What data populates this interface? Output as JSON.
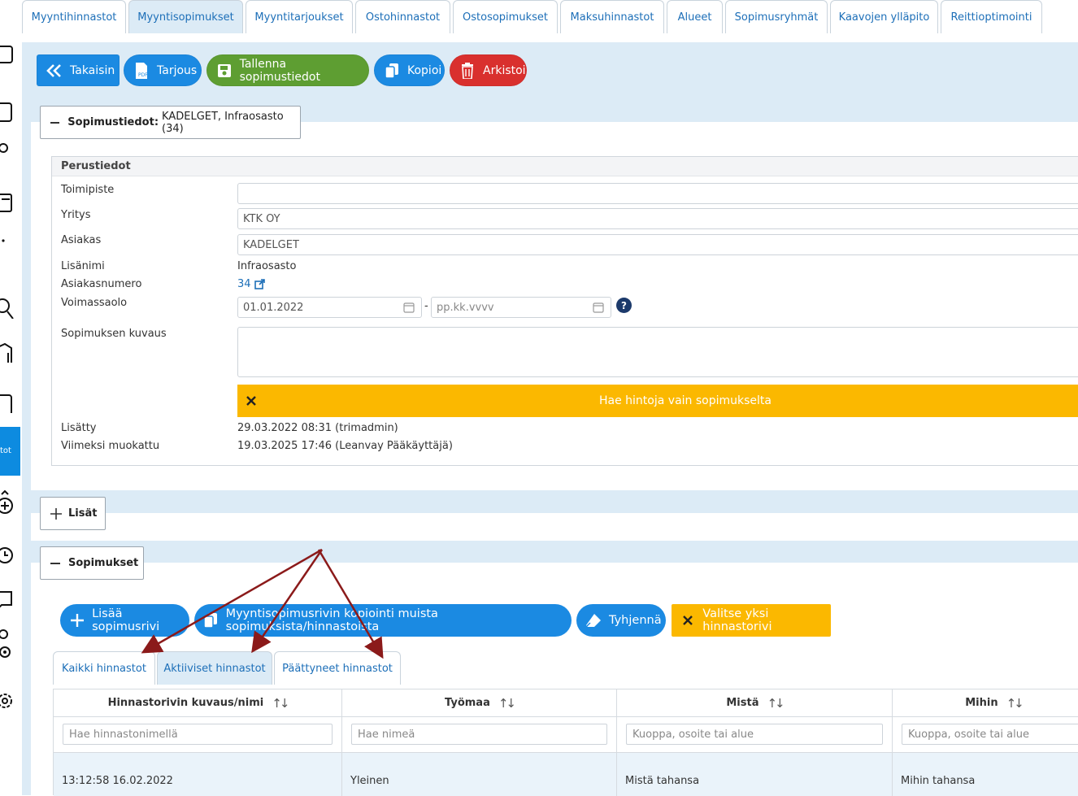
{
  "top_tabs": [
    {
      "label": "Myyntihinnastot"
    },
    {
      "label": "Myyntisopimukset"
    },
    {
      "label": "Myyntitarjoukset"
    },
    {
      "label": "Ostohinnastot"
    },
    {
      "label": "Ostosopimukset"
    },
    {
      "label": "Maksuhinnastot"
    },
    {
      "label": "Alueet"
    },
    {
      "label": "Sopimusryhmät"
    },
    {
      "label": "Kaavojen ylläpito"
    },
    {
      "label": "Reittioptimointi"
    }
  ],
  "sidebar": {
    "active_label": "tot"
  },
  "toolbar": {
    "back": "Takaisin",
    "offer": "Tarjous",
    "save": "Tallenna sopimustiedot",
    "copy": "Kopioi",
    "archive": "Arkistoi"
  },
  "contract_section": {
    "title_bold": "Sopimustiedot:",
    "title_rest": "KADELGET, Infraosasto (34)",
    "fieldset_legend": "Perustiedot",
    "labels": {
      "toimipiste": "Toimipiste",
      "yritys": "Yritys",
      "asiakas": "Asiakas",
      "lisanimi": "Lisänimi",
      "asiakasnumero": "Asiakasnumero",
      "voimassaolo": "Voimassaolo",
      "kuvaus": "Sopimuksen kuvaus",
      "lisatty": "Lisätty",
      "muokattu": "Viimeksi muokattu"
    },
    "values": {
      "toimipiste": "",
      "yritys": "KTK OY",
      "asiakas": "KADELGET",
      "lisanimi": "Infraosasto",
      "asiakasnumero": "34",
      "valid_from": "01.01.2022",
      "valid_to_placeholder": "pp.kk.vvvv",
      "dash": "-",
      "help": "?",
      "price_toggle": "Hae hintoja vain sopimukselta",
      "lisatty": "29.03.2022 08:31 (trimadmin)",
      "muokattu": "19.03.2025 17:46 (Leanvay Pääkäyttäjä)"
    }
  },
  "extras_section": {
    "title": "Lisät"
  },
  "contracts_section": {
    "title": "Sopimukset",
    "buttons": {
      "add_row": "Lisää sopimusrivi",
      "copy_rows": "Myyntisopimusrivin kopiointi muista sopimuksista/hinnastoista",
      "clear": "Tyhjennä",
      "select_one": "Valitse yksi hinnastorivi"
    },
    "tabs": [
      {
        "label": "Kaikki hinnastot"
      },
      {
        "label": "Aktiiviset hinnastot"
      },
      {
        "label": "Päättyneet hinnastot"
      }
    ],
    "columns": [
      {
        "header": "Hinnastorivin kuvaus/nimi",
        "filter_placeholder": "Hae hinnastonimellä"
      },
      {
        "header": "Työmaa",
        "filter_placeholder": "Hae nimeä"
      },
      {
        "header": "Mistä",
        "filter_placeholder": "Kuoppa, osoite tai alue"
      },
      {
        "header": "Mihin",
        "filter_placeholder": "Kuoppa, osoite tai alue"
      }
    ],
    "rows": [
      [
        "13:12:58 16.02.2022",
        "Yleinen",
        "Mistä tahansa",
        "Mihin tahansa"
      ]
    ]
  },
  "colors": {
    "primary": "#1b8ae2",
    "success": "#5e9e32",
    "danger": "#d9302e",
    "warning": "#fbb800",
    "panel": "#dcebf6",
    "arrow": "#8b1a1a"
  }
}
